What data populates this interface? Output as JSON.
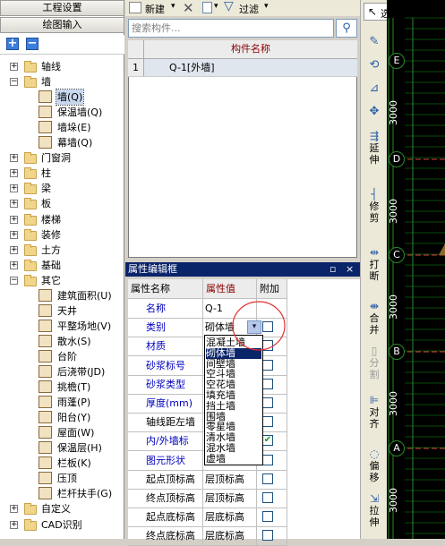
{
  "left": {
    "btn_project": "工程设置",
    "btn_draw": "绘图输入",
    "tree": [
      {
        "label": "轴线",
        "state": "+",
        "level": 0,
        "icon": "folder-icon"
      },
      {
        "label": "墙",
        "state": "-",
        "level": 0,
        "icon": "folder-icon"
      },
      {
        "label": "墙(Q)",
        "level": 1,
        "icon": "wall-icon",
        "selected": true
      },
      {
        "label": "保温墙(Q)",
        "level": 1,
        "icon": "insulation-wall-icon"
      },
      {
        "label": "墙垛(E)",
        "level": 1,
        "icon": "wall-pier-icon"
      },
      {
        "label": "幕墙(Q)",
        "level": 1,
        "icon": "curtain-wall-icon"
      },
      {
        "label": "门窗洞",
        "state": "+",
        "level": 0,
        "icon": "folder-icon"
      },
      {
        "label": "柱",
        "state": "+",
        "level": 0,
        "icon": "folder-icon"
      },
      {
        "label": "梁",
        "state": "+",
        "level": 0,
        "icon": "folder-icon"
      },
      {
        "label": "板",
        "state": "+",
        "level": 0,
        "icon": "folder-icon"
      },
      {
        "label": "楼梯",
        "state": "+",
        "level": 0,
        "icon": "folder-icon"
      },
      {
        "label": "装修",
        "state": "+",
        "level": 0,
        "icon": "folder-icon"
      },
      {
        "label": "土方",
        "state": "+",
        "level": 0,
        "icon": "folder-icon"
      },
      {
        "label": "基础",
        "state": "+",
        "level": 0,
        "icon": "folder-icon"
      },
      {
        "label": "其它",
        "state": "-",
        "level": 0,
        "icon": "folder-icon"
      },
      {
        "label": "建筑面积(U)",
        "level": 1,
        "icon": "building-area-icon"
      },
      {
        "label": "天井",
        "level": 1,
        "icon": "patio-icon"
      },
      {
        "label": "平整场地(V)",
        "level": 1,
        "icon": "site-leveling-icon"
      },
      {
        "label": "散水(S)",
        "level": 1,
        "icon": "apron-icon"
      },
      {
        "label": "台阶",
        "level": 1,
        "icon": "steps-icon"
      },
      {
        "label": "后浇带(JD)",
        "level": 1,
        "icon": "post-cast-strip-icon"
      },
      {
        "label": "挑檐(T)",
        "level": 1,
        "icon": "eave-icon"
      },
      {
        "label": "雨蓬(P)",
        "level": 1,
        "icon": "canopy-icon"
      },
      {
        "label": "阳台(Y)",
        "level": 1,
        "icon": "balcony-icon"
      },
      {
        "label": "屋面(W)",
        "level": 1,
        "icon": "roof-icon"
      },
      {
        "label": "保温层(H)",
        "level": 1,
        "icon": "insulation-layer-icon"
      },
      {
        "label": "栏板(K)",
        "level": 1,
        "icon": "parapet-icon"
      },
      {
        "label": "压顶",
        "level": 1,
        "icon": "coping-icon"
      },
      {
        "label": "栏杆扶手(G)",
        "level": 1,
        "icon": "railing-icon"
      },
      {
        "label": "自定义",
        "state": "+",
        "level": 0,
        "icon": "folder-icon"
      },
      {
        "label": "CAD识别",
        "state": "+",
        "level": 0,
        "icon": "folder-icon"
      }
    ]
  },
  "toolbar": {
    "new_label": "新建",
    "filter_label": "过滤"
  },
  "search": {
    "placeholder": "搜索构件..."
  },
  "component_list": {
    "header": "构件名称",
    "rows": [
      {
        "index": "1",
        "name": "Q-1[外墙]"
      }
    ]
  },
  "props": {
    "title": "属性编辑框",
    "pin": "ᵖ",
    "close": "×",
    "col_name": "属性名称",
    "col_value": "属性值",
    "col_add": "附加",
    "rows": [
      {
        "name": "名称",
        "value": "Q-1",
        "blue": true,
        "cb": false
      },
      {
        "name": "类别",
        "value": "砌体墙",
        "blue": true,
        "cb": true
      },
      {
        "name": "材质",
        "value": "",
        "blue": true,
        "cb": true
      },
      {
        "name": "砂浆标号",
        "value": "",
        "blue": true,
        "cb": true
      },
      {
        "name": "砂浆类型",
        "value": "",
        "blue": true,
        "cb": true
      },
      {
        "name": "厚度(mm)",
        "value": "",
        "blue": true,
        "cb": true
      },
      {
        "name": "轴线距左墙",
        "value": "",
        "blue": false,
        "cb": true
      },
      {
        "name": "内/外墙标",
        "value": "",
        "blue": true,
        "cb": true,
        "checked": true
      },
      {
        "name": "图元形状",
        "value": "",
        "blue": true,
        "cb": true
      },
      {
        "name": "起点顶标高",
        "value": "层顶标高",
        "blue": false,
        "cb": true
      },
      {
        "name": "终点顶标高",
        "value": "层顶标高",
        "blue": false,
        "cb": true
      },
      {
        "name": "起点底标高",
        "value": "层底标高",
        "blue": false,
        "cb": true
      },
      {
        "name": "终点底标高",
        "value": "层底标高",
        "blue": false,
        "cb": true
      }
    ],
    "dropdown": [
      "混凝土墙",
      "砌体墙",
      "间壁墙",
      "空斗墙",
      "空花墙",
      "填充墙",
      "挡土墙",
      "围墙",
      "零星墙",
      "清水墙",
      "混水墙",
      "虚墙"
    ],
    "dropdown_selected": 1
  },
  "right_toolbar": {
    "select_label": "选择",
    "buttons": [
      "延伸",
      "修剪",
      "打断",
      "合并",
      "分割",
      "对齐",
      "偏移",
      "拉伸"
    ]
  },
  "canvas": {
    "axis_labels": [
      "E",
      "D",
      "C",
      "B",
      "A"
    ],
    "dims": [
      "3000",
      "3000",
      "3000",
      "3000",
      "3000"
    ]
  },
  "colors": {
    "title_bar": "#0a246a",
    "accent": "#2b5fa8",
    "highlight_circle": "#e03030"
  }
}
